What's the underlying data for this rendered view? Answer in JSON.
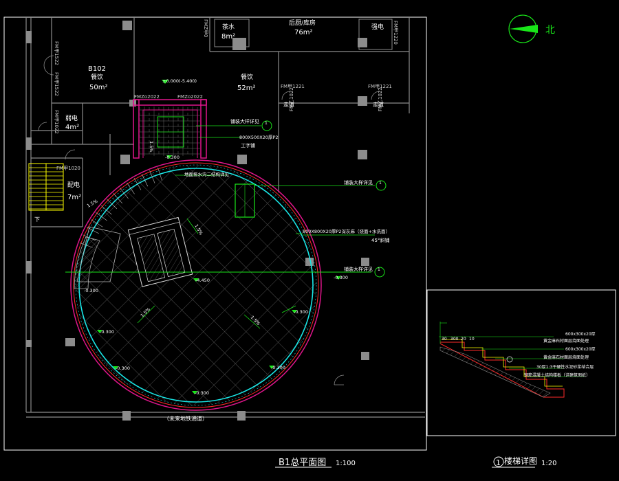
{
  "colors": {
    "background": "#000000",
    "frame": "#ffffff",
    "wall": "#8c8c8c",
    "magenta": "#e0158c",
    "red": "#ff2a2a",
    "cyan": "#19e6e6",
    "green": "#19e619",
    "yellow": "#ffff00",
    "hatch": "#6c6c6c",
    "text": "#ffffff"
  },
  "main_plan": {
    "title": "B1总平面图",
    "scale": "1:100",
    "caption": "（未来地铁通道）",
    "rooms": [
      {
        "code": "B102",
        "name": "餐饮",
        "area": "50m²"
      },
      {
        "name": "餐饮",
        "area": "52m²"
      },
      {
        "name": "茶水",
        "area": "8m²"
      },
      {
        "name": "后厨/库房",
        "area": "76m²"
      },
      {
        "name": "弱电",
        "area": "4m²"
      },
      {
        "name": "配电",
        "area": "7m²"
      },
      {
        "name": "强电"
      },
      {
        "name": "走道"
      },
      {
        "name": "走道"
      }
    ],
    "door_tags": [
      "FM甲1522",
      "FM甲1522",
      "FMZ甲0",
      "FMZo2022",
      "FMZo2022",
      "FM甲1221",
      "FM甲1221",
      "FM甲1022",
      "FM甲1020",
      "FM甲1220",
      "FM乙1022",
      "FM乙1022"
    ],
    "level_labels": [
      "±0.000(-5.400)",
      "-0.300",
      "-0.300",
      "-4.450",
      "-0.300",
      "-0.300",
      "-0.300",
      "-0.300",
      "-0.300",
      "-0.300"
    ],
    "slope_labels": [
      "1.5%",
      "1.5%",
      "1.5%",
      "1.5%",
      "1.5%"
    ],
    "stair_mark": "下",
    "callouts": [
      {
        "text": "铺装大样详见",
        "ref": "1"
      },
      {
        "text": "800X500X20厚P2",
        "ref": ""
      },
      {
        "text": "工字铺",
        "ref": ""
      },
      {
        "text": "铺装大样详见",
        "ref": "1"
      },
      {
        "text": "800X800X20厚P2深灰麻（烧面+水洗面）",
        "ref": ""
      },
      {
        "text": "45°斜铺",
        "ref": ""
      },
      {
        "text": "铺装大样详见",
        "ref": "1"
      },
      {
        "text": "地面排水沟二结构详见",
        "ref": ""
      }
    ]
  },
  "detail": {
    "title": "楼梯详图",
    "number": "1",
    "scale": "1:20",
    "dims": [
      "30",
      "300",
      "20",
      "10"
    ],
    "layers": [
      "600x300x20厚",
      "黄金麻石材面层烧面处理",
      "600x300x20厚",
      "黄金麻石材面层烧面处理",
      "30厚1:3干硬性水泥砂浆结合层",
      "钢筋混凝土结构楼板（详建筑图纸）"
    ]
  },
  "north": {
    "label": "北"
  }
}
